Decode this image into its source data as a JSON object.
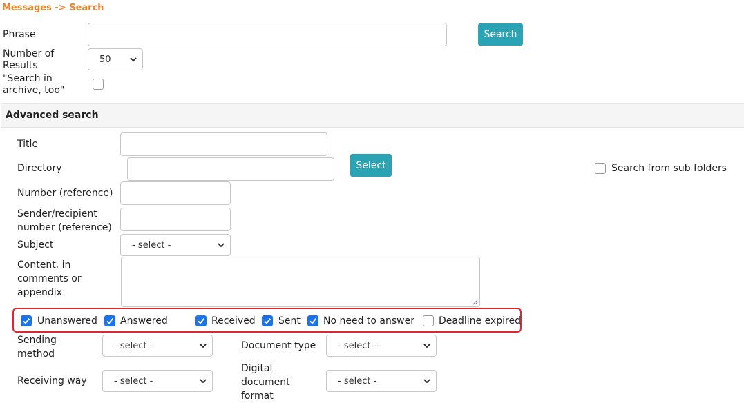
{
  "breadcrumb": "Messages -> Search",
  "phrase": {
    "label": "Phrase",
    "value": ""
  },
  "search_button": "Search",
  "results": {
    "label_line1": "Number of",
    "label_line2": "Results",
    "selected": "50"
  },
  "archive": {
    "label_line1": "\"Search in",
    "label_line2": "archive, too\"",
    "checked": false
  },
  "advanced": {
    "heading": "Advanced search",
    "title_label": "Title",
    "directory_label": "Directory",
    "select_button": "Select",
    "subfolders_label": "Search from sub folders",
    "number_label": "Number (reference)",
    "sender_label_line1": "Sender/recipient",
    "sender_label_line2": "number (reference)",
    "subject_label": "Subject",
    "subject_selected": "- select -",
    "content_label_line1": "Content, in",
    "content_label_line2": "comments or",
    "content_label_line3": "appendix"
  },
  "status_filters": [
    {
      "label": "Unanswered",
      "checked": true
    },
    {
      "label": "Answered",
      "checked": true
    },
    {
      "label": "Received",
      "checked": true
    },
    {
      "label": "Sent",
      "checked": true
    },
    {
      "label": "No need to answer",
      "checked": true
    },
    {
      "label": "Deadline expired",
      "checked": false
    }
  ],
  "sending_method": {
    "label_line1": "Sending",
    "label_line2": "method",
    "selected": "- select -"
  },
  "document_type": {
    "label": "Document type",
    "selected": "- select -"
  },
  "receiving_way": {
    "label": "Receiving way",
    "selected": "- select -"
  },
  "digital_format": {
    "label_line1": "Digital",
    "label_line2": "document",
    "label_line3": "format",
    "selected": "- select -"
  },
  "colors": {
    "accent": "#2aa3b5",
    "breadcrumb": "#e8842b",
    "checkbox": "#1a73e8",
    "highlight": "#e0262e"
  }
}
